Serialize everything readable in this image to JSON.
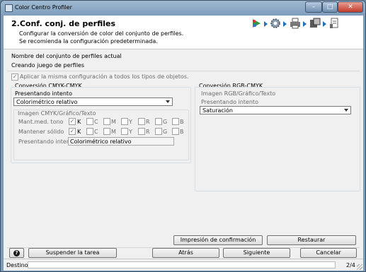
{
  "window": {
    "title": "Color Centro Profiler"
  },
  "header": {
    "step_title": "2.Conf. conj. de perfiles",
    "description_line1": "Configurar la conversión de color del conjunto de perfiles.",
    "description_line2": "Se recomienda la configuración predeterminada."
  },
  "profile_set": {
    "name_label": "Nombre del conjunto de perfiles actual",
    "name_value": "Creando juego de perfiles",
    "apply_all_label": "Aplicar la misma configuración a todos los tipos de objetos.",
    "apply_all_checked": true
  },
  "cmyk": {
    "section_title": "Conversión CMYK-CMYK",
    "intent_label": "Presentando intento",
    "intent_value": "Colorimétrico relativo",
    "group_title": "Imagen CMYK/Gráfico/Texto",
    "rows": [
      {
        "label": "Mant.med. tono",
        "channels": [
          {
            "name": "K",
            "checked": true
          },
          {
            "name": "C",
            "checked": false
          },
          {
            "name": "M",
            "checked": false
          },
          {
            "name": "Y",
            "checked": false
          },
          {
            "name": "R",
            "checked": false
          },
          {
            "name": "G",
            "checked": false
          },
          {
            "name": "B",
            "checked": false
          }
        ]
      },
      {
        "label": "Mantener sólido",
        "channels": [
          {
            "name": "K",
            "checked": true
          },
          {
            "name": "C",
            "checked": false
          },
          {
            "name": "M",
            "checked": false
          },
          {
            "name": "Y",
            "checked": false
          },
          {
            "name": "R",
            "checked": false
          },
          {
            "name": "G",
            "checked": false
          },
          {
            "name": "B",
            "checked": false
          }
        ]
      }
    ],
    "intent2_label": "Presentando intento",
    "intent2_value": "Colorimétrico relativo"
  },
  "rgb": {
    "section_title": "Conversión RGB-CMYK",
    "group_title": "Imagen RGB/Gráfico/Texto",
    "intent_label": "Presentando intento",
    "intent_value": "Saturación"
  },
  "buttons": {
    "print_confirm": "Impresión de confirmación",
    "restore": "Restaurar",
    "help": "?",
    "suspend": "Suspender la tarea",
    "back": "Atrás",
    "next": "Siguiente",
    "cancel": "Cancelar"
  },
  "status": {
    "destination_label": "Destino actual",
    "page_indicator": "2/4"
  },
  "colors": {
    "accent": "#1e73be",
    "titlebar": "#7c9cbb",
    "panel": "#f0f0f0"
  }
}
